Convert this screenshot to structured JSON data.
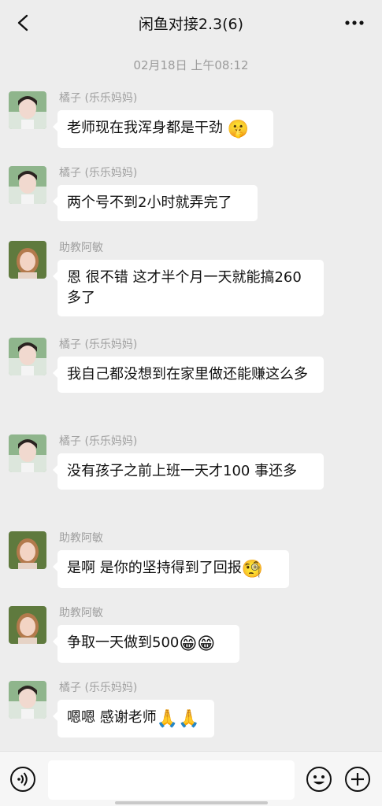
{
  "header": {
    "title": "闲鱼对接2.3(6)"
  },
  "timestamp": "02月18日 上午08:12",
  "messages": [
    {
      "sender": "橘子 (乐乐妈妈)",
      "avatar": "orange-avatar",
      "text": "老师现在我浑身都是干劲",
      "emoji": "🤫"
    },
    {
      "sender": "橘子 (乐乐妈妈)",
      "avatar": "orange-avatar",
      "text": "两个号不到2小时就弄完了",
      "emoji": ""
    },
    {
      "sender": "助教阿敏",
      "avatar": "assistant-avatar",
      "text": "恩 很不错 这才半个月一天就能搞260多了",
      "emoji": ""
    },
    {
      "sender": "橘子 (乐乐妈妈)",
      "avatar": "orange-avatar",
      "text": "我自己都没想到在家里做还能赚这么多",
      "emoji": ""
    },
    {
      "sender": "橘子 (乐乐妈妈)",
      "avatar": "orange-avatar",
      "text": "没有孩子之前上班一天才100 事还多",
      "emoji": ""
    },
    {
      "sender": "助教阿敏",
      "avatar": "assistant-avatar",
      "text": "是啊 是你的坚持得到了回报",
      "emoji": "🧐"
    },
    {
      "sender": "助教阿敏",
      "avatar": "assistant-avatar",
      "text": "争取一天做到500",
      "emoji": "😁😁"
    },
    {
      "sender": "橘子 (乐乐妈妈)",
      "avatar": "orange-avatar",
      "text": "嗯嗯 感谢老师",
      "emoji": "🙏🙏"
    }
  ],
  "input": {
    "value": ""
  },
  "icons": {
    "back": "chevron-left-icon",
    "more": "more-dots-icon",
    "voice": "voice-icon",
    "emoji": "smiley-icon",
    "plus": "plus-icon"
  }
}
